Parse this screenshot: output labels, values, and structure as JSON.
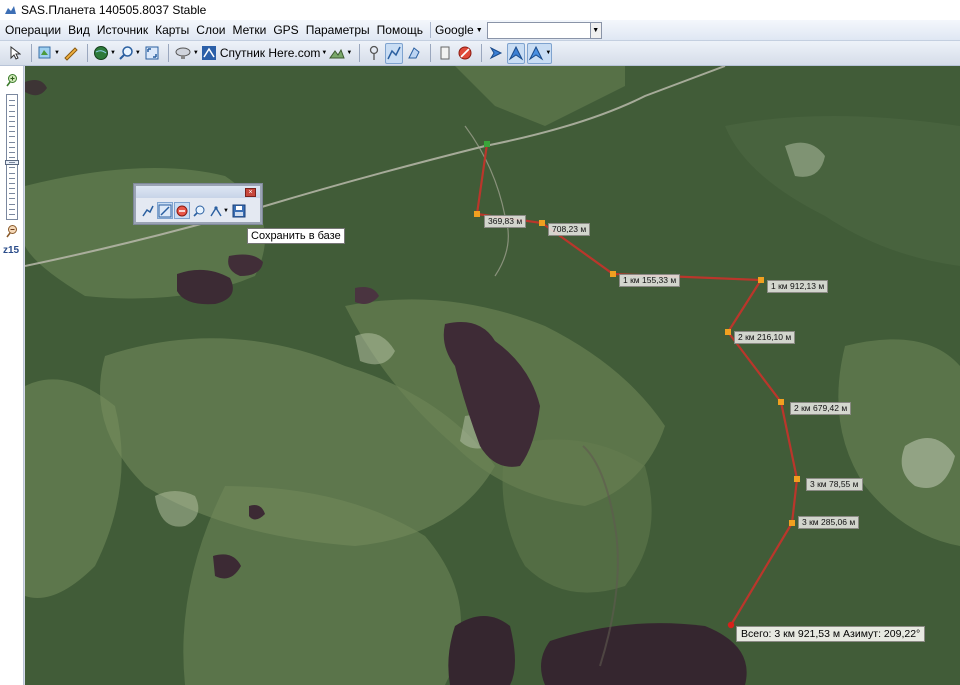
{
  "window": {
    "title": "SAS.Планета 140505.8037 Stable"
  },
  "menu": {
    "items": [
      "Операции",
      "Вид",
      "Источник",
      "Карты",
      "Слои",
      "Метки",
      "GPS",
      "Параметры",
      "Помощь"
    ],
    "search_engine": "Google",
    "search_value": ""
  },
  "toolbar": {
    "map_source": "Спутник Here.com",
    "icons": [
      "cursor-icon",
      "layers-icon",
      "ruler-icon",
      "globe-icon",
      "magnifier-icon",
      "fullscreen-icon",
      "satellite-dish-icon",
      "map-type-icon",
      "terrain-icon",
      "pin-icon",
      "path-icon",
      "polygon-icon",
      "marks-icon",
      "stop-icon",
      "gps-arrow-icon",
      "gps-track-icon",
      "gps-center-icon"
    ]
  },
  "zoom": {
    "level_label": "z15",
    "slider_fraction": 0.55
  },
  "route_panel": {
    "tooltip": "Сохранить в базе"
  },
  "measurement": {
    "segments": [
      "369,83 м",
      "708,23 м",
      "1 км 155,33 м",
      "1 км 912,13 м",
      "2 км 216,10 м",
      "2 км 679,42 м",
      "3 км 78,55 м",
      "3 км 285,06 м"
    ],
    "total": "Всего: 3 км 921,53 м Азимут: 209,22°"
  },
  "colors": {
    "route_line": "#c8322a",
    "route_node": "#f0a020",
    "start_node": "#3aa53a",
    "end_node": "#d8201a",
    "forest": "#3f5a36",
    "water": "#3a2a33"
  }
}
